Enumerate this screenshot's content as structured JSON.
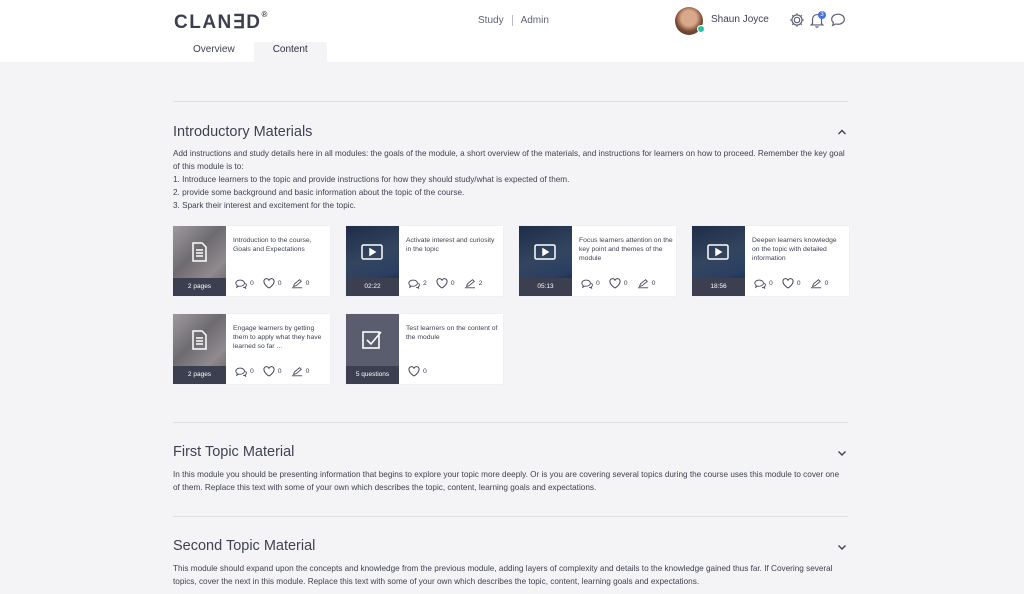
{
  "header": {
    "logo_text": "CLAN∃D",
    "logo_mark": "®",
    "nav": [
      {
        "label": "Study"
      },
      {
        "label": "Admin"
      }
    ],
    "user_name": "Shaun Joyce",
    "notification_count": "3",
    "icons": [
      "settings-icon",
      "bell-icon",
      "chat-bubble-icon"
    ]
  },
  "tabs": [
    {
      "label": "Overview",
      "active": false
    },
    {
      "label": "Content",
      "active": true
    }
  ],
  "sections": [
    {
      "title": "Introductory Materials",
      "expanded": true,
      "description": [
        "Add instructions and study details here in all modules: the goals of the module, a short overview of the materials, and instructions for learners on how to proceed. Remember the key goal of this module is to:",
        "1. Introduce learners to the topic and provide instructions for how they should study/what is expected of them.",
        "2. provide some background and basic information about the topic of the course.",
        "3. Spark their interest and excitement for the topic."
      ],
      "cards": [
        {
          "type": "document",
          "thumb_label": "2 pages",
          "title": "Introduction to the course, Goals and Expectations",
          "comments": "0",
          "likes": "0",
          "annotations": "0"
        },
        {
          "type": "video",
          "thumb_label": "02:22",
          "title": "Activate interest and curiosity in the topic",
          "comments": "2",
          "likes": "0",
          "annotations": "2"
        },
        {
          "type": "video",
          "thumb_label": "05:13",
          "title": "Focus learners attention on the key point and themes of the module",
          "comments": "0",
          "likes": "0",
          "annotations": "0"
        },
        {
          "type": "video",
          "thumb_label": "18:56",
          "title": "Deepen learners knowledge on the topic with detailed information",
          "comments": "0",
          "likes": "0",
          "annotations": "0"
        },
        {
          "type": "document",
          "thumb_label": "2 pages",
          "title": "Engage learners by getting them to apply what they have learned so far ...",
          "comments": "0",
          "likes": "0",
          "annotations": "0"
        },
        {
          "type": "quiz",
          "thumb_label": "5 questions",
          "title": "Test learners on the content of the module",
          "likes": "0"
        }
      ]
    },
    {
      "title": "First Topic Material",
      "expanded": false,
      "description": "In this module you should be presenting information that begins to explore your topic more deeply. Or is you are covering several topics during the course uses this module to cover one of them. Replace this text with some of your own which describes the topic, content, learning goals and expectations."
    },
    {
      "title": "Second Topic Material",
      "expanded": false,
      "description": "This module should expand upon the concepts and knowledge from the previous module, adding layers of complexity and details to the knowledge gained thus far. If Covering several topics, cover the next in this module. Replace this text with some of your own which describes the topic, content, learning goals and expectations."
    }
  ],
  "colors": {
    "background": "#f4f4f7",
    "text": "#3f4252",
    "badge": "#4a6ee0",
    "online": "#2fc1a8",
    "thumb_label_bg": "#3c3f50"
  }
}
